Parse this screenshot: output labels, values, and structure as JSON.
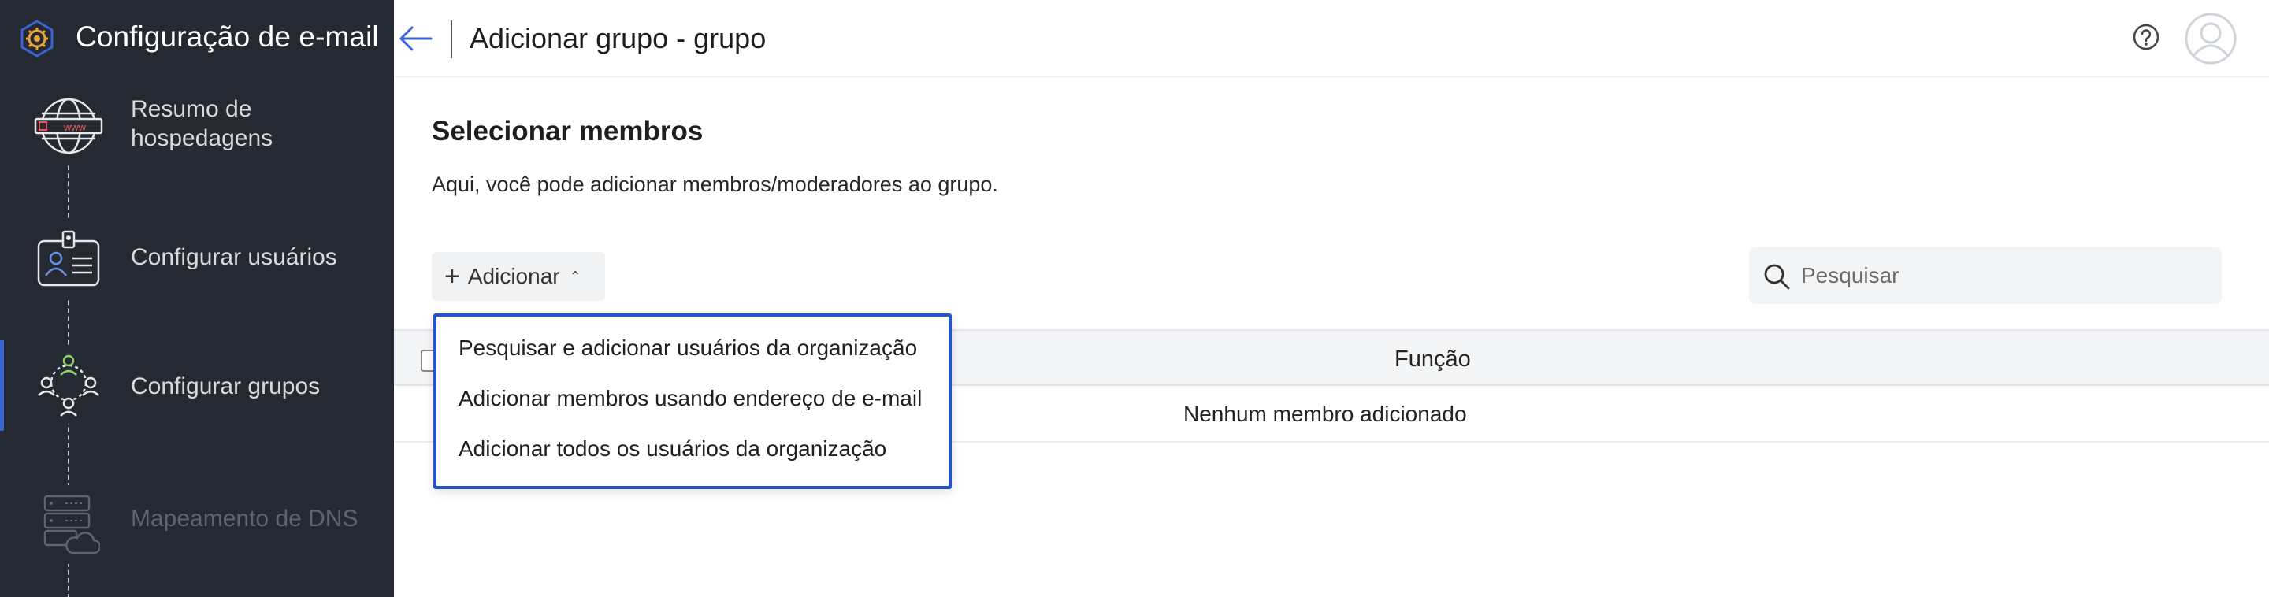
{
  "app": {
    "title": "Configuração de e-mail"
  },
  "sidebar": {
    "steps": [
      {
        "label_line1": "Resumo de",
        "label_line2": "hospedagens",
        "icon": "globe-www-icon",
        "state": "done"
      },
      {
        "label": "Configurar usuários",
        "icon": "id-card-icon",
        "state": "done"
      },
      {
        "label": "Configurar grupos",
        "icon": "group-network-icon",
        "state": "active"
      },
      {
        "label": "Mapeamento de DNS",
        "icon": "server-cloud-icon",
        "state": "disabled"
      }
    ]
  },
  "header": {
    "title": "Adicionar grupo - grupo",
    "help_icon": "help-icon",
    "avatar_icon": "user-avatar-icon"
  },
  "main": {
    "section_title": "Selecionar membros",
    "section_desc": "Aqui, você pode adicionar membros/moderadores ao grupo.",
    "add_button": "Adicionar",
    "search_placeholder": "Pesquisar",
    "table": {
      "columns": [
        "",
        "Função"
      ],
      "empty_message": "Nenhum membro adicionado"
    },
    "dropdown": {
      "items": [
        "Pesquisar e adicionar usuários da organização",
        "Adicionar membros usando endereço de e-mail",
        "Adicionar todos os usuários da organização"
      ]
    }
  },
  "colors": {
    "sidebar_bg": "#252932",
    "accent": "#3b63d6",
    "dropdown_border": "#2553c9",
    "logo_orange": "#e8a33a"
  }
}
